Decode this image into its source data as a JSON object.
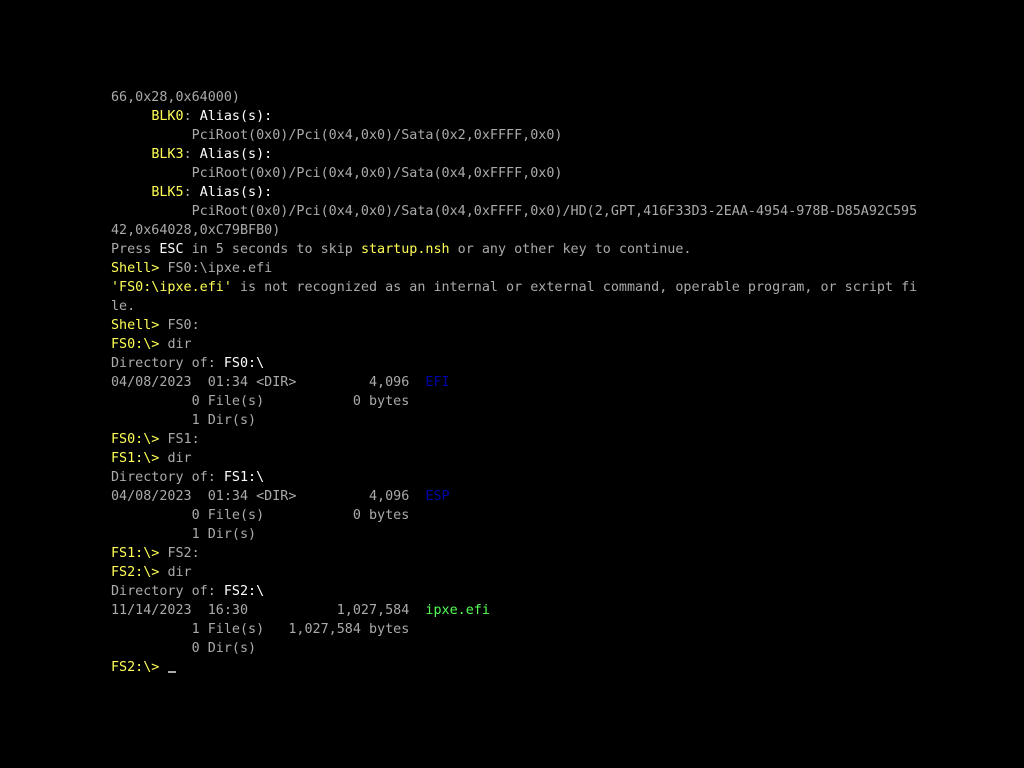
{
  "colors": {
    "background": "#000000",
    "default_text": "#aaaaaa",
    "highlight_yellow": "#ffff55",
    "bright_white": "#ffffff",
    "directory_blue": "#0000aa",
    "file_green": "#55ff55"
  },
  "lines": [
    [
      {
        "t": "66,0x28,0x64000)",
        "c": "g"
      }
    ],
    [
      {
        "t": "     ",
        "c": "g"
      },
      {
        "t": "BLK0",
        "c": "y"
      },
      {
        "t": ": ",
        "c": "g"
      },
      {
        "t": "Alias(s):",
        "c": "w"
      }
    ],
    [
      {
        "t": "          PciRoot(0x0)/Pci(0x4,0x0)/Sata(0x2,0xFFFF,0x0)",
        "c": "g"
      }
    ],
    [
      {
        "t": "     ",
        "c": "g"
      },
      {
        "t": "BLK3",
        "c": "y"
      },
      {
        "t": ": ",
        "c": "g"
      },
      {
        "t": "Alias(s):",
        "c": "w"
      }
    ],
    [
      {
        "t": "          PciRoot(0x0)/Pci(0x4,0x0)/Sata(0x4,0xFFFF,0x0)",
        "c": "g"
      }
    ],
    [
      {
        "t": "     ",
        "c": "g"
      },
      {
        "t": "BLK5",
        "c": "y"
      },
      {
        "t": ": ",
        "c": "g"
      },
      {
        "t": "Alias(s):",
        "c": "w"
      }
    ],
    [
      {
        "t": "          PciRoot(0x0)/Pci(0x4,0x0)/Sata(0x4,0xFFFF,0x0)/HD(2,GPT,416F33D3-2EAA-4954-978B-D85A92C595",
        "c": "g"
      }
    ],
    [
      {
        "t": "42,0x64028,0xC79BFB0)",
        "c": "g"
      }
    ],
    [
      {
        "t": "Press ",
        "c": "g"
      },
      {
        "t": "ESC",
        "c": "w"
      },
      {
        "t": " in 5 seconds to skip ",
        "c": "g"
      },
      {
        "t": "startup.nsh",
        "c": "y"
      },
      {
        "t": " or any other key to continue.",
        "c": "g"
      }
    ],
    [
      {
        "t": "Shell> ",
        "c": "y"
      },
      {
        "t": "FS0:\\ipxe.efi",
        "c": "g"
      }
    ],
    [
      {
        "t": "'FS0:\\ipxe.efi'",
        "c": "y"
      },
      {
        "t": " is not recognized as an internal or external command, operable program, or script fi",
        "c": "g"
      }
    ],
    [
      {
        "t": "le.",
        "c": "g"
      }
    ],
    [
      {
        "t": "Shell> ",
        "c": "y"
      },
      {
        "t": "FS0:",
        "c": "g"
      }
    ],
    [
      {
        "t": "FS0:\\> ",
        "c": "y"
      },
      {
        "t": "dir",
        "c": "g"
      }
    ],
    [
      {
        "t": "Directory of: ",
        "c": "g"
      },
      {
        "t": "FS0:\\",
        "c": "w"
      }
    ],
    [
      {
        "t": "04/08/2023  01:34 <DIR>         4,096  ",
        "c": "g"
      },
      {
        "t": "EFI",
        "c": "b"
      }
    ],
    [
      {
        "t": "          0 File(s)           0 bytes",
        "c": "g"
      }
    ],
    [
      {
        "t": "          1 Dir(s)",
        "c": "g"
      }
    ],
    [
      {
        "t": "FS0:\\> ",
        "c": "y"
      },
      {
        "t": "FS1:",
        "c": "g"
      }
    ],
    [
      {
        "t": "FS1:\\> ",
        "c": "y"
      },
      {
        "t": "dir",
        "c": "g"
      }
    ],
    [
      {
        "t": "Directory of: ",
        "c": "g"
      },
      {
        "t": "FS1:\\",
        "c": "w"
      }
    ],
    [
      {
        "t": "04/08/2023  01:34 <DIR>         4,096  ",
        "c": "g"
      },
      {
        "t": "ESP",
        "c": "b"
      }
    ],
    [
      {
        "t": "          0 File(s)           0 bytes",
        "c": "g"
      }
    ],
    [
      {
        "t": "          1 Dir(s)",
        "c": "g"
      }
    ],
    [
      {
        "t": "FS1:\\> ",
        "c": "y"
      },
      {
        "t": "FS2:",
        "c": "g"
      }
    ],
    [
      {
        "t": "FS2:\\> ",
        "c": "y"
      },
      {
        "t": "dir",
        "c": "g"
      }
    ],
    [
      {
        "t": "Directory of: ",
        "c": "g"
      },
      {
        "t": "FS2:\\",
        "c": "w"
      }
    ],
    [
      {
        "t": "11/14/2023  16:30           1,027,584  ",
        "c": "g"
      },
      {
        "t": "ipxe.efi",
        "c": "lg"
      }
    ],
    [
      {
        "t": "          1 File(s)   1,027,584 bytes",
        "c": "g"
      }
    ],
    [
      {
        "t": "          0 Dir(s)",
        "c": "g"
      }
    ],
    [
      {
        "t": "FS2:\\> ",
        "c": "y"
      },
      {
        "t": "",
        "c": "g"
      }
    ]
  ]
}
